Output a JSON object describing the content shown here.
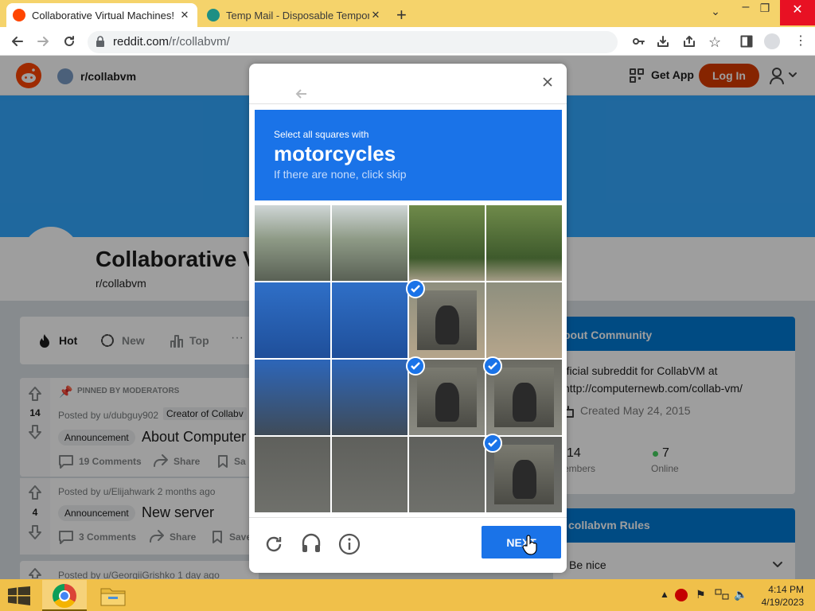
{
  "browser": {
    "tabs": [
      {
        "title": "Collaborative Virtual Machines!",
        "active": true
      },
      {
        "title": "Temp Mail - Disposable Tempora",
        "active": false
      }
    ],
    "url_host": "reddit.com",
    "url_path": "/r/collabvm/"
  },
  "reddit": {
    "community_name": "r/collabvm",
    "get_app": "Get App",
    "login": "Log In",
    "title": "Collaborative V",
    "subtitle": "r/collabvm",
    "sort": [
      "Hot",
      "New",
      "Top"
    ],
    "posts": [
      {
        "pinned_label": "PINNED BY MODERATORS",
        "votes": "14",
        "meta": "Posted by u/dubguy902",
        "flair_user": "Creator of Collabv",
        "flair": "Announcement",
        "title": "About Computer",
        "comments": "19 Comments",
        "share": "Share",
        "save": "Sa"
      },
      {
        "votes": "4",
        "meta": "Posted by u/Elijahwark 2 months ago",
        "flair": "Announcement",
        "title": "New server",
        "comments": "3 Comments",
        "share": "Share",
        "save": "Save"
      },
      {
        "meta": "Posted by u/GeorgiiGrishko 1 day ago"
      }
    ],
    "about": {
      "header": "bout Community",
      "desc": "fficial subreddit for CollabVM at http://computernewb.com/collab-vm/",
      "created": "Created May 24, 2015",
      "members_value": "14",
      "members_label": "embers",
      "online_value": "7",
      "online_label": "Online"
    },
    "rules": {
      "header": "collabvm Rules",
      "first": "Be nice"
    }
  },
  "captcha": {
    "instruction": "Select all squares with",
    "target": "motorcycles",
    "hint": "If there are none, click skip",
    "selected_tiles": [
      6,
      10,
      11,
      15
    ],
    "next_label": "NEXT"
  },
  "taskbar": {
    "time": "4:14 PM",
    "date": "4/19/2023"
  },
  "colors": {
    "captcha_blue": "#1a73e8",
    "reddit_orange": "#ff4500",
    "login_bg": "#d93a00",
    "taskbar": "#f0c04a"
  }
}
